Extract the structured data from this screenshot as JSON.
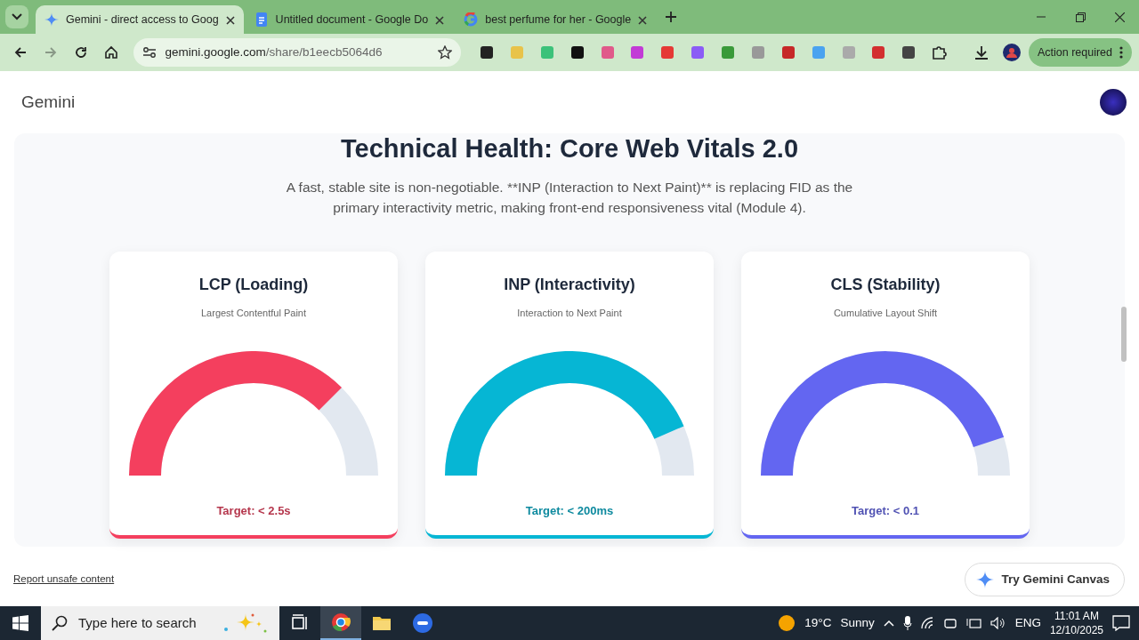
{
  "browser": {
    "tabs": [
      {
        "title": "Gemini - direct access to Goog",
        "kind": "gemini",
        "selected": true
      },
      {
        "title": "Untitled document - Google Do",
        "kind": "docs",
        "selected": false
      },
      {
        "title": "best perfume for her - Google",
        "kind": "google",
        "selected": false
      }
    ],
    "address": {
      "host": "gemini.google.com",
      "path": "/share/b1eecb5064d6"
    },
    "action_button": "Action required"
  },
  "page": {
    "app_title": "Gemini",
    "heading": "Technical Health: Core Web Vitals 2.0",
    "description": "A fast, stable site is non-negotiable. **INP (Interaction to Next Paint)** is replacing FID as the primary interactivity metric, making front-end responsiveness vital (Module 4).",
    "metrics": [
      {
        "title": "LCP (Loading)",
        "subtitle": "Largest Contentful Paint",
        "color": "#f43f5e",
        "target": "Target: < 2.5s"
      },
      {
        "title": "INP (Interactivity)",
        "subtitle": "Interaction to Next Paint",
        "color": "#06b6d4",
        "target": "Target: < 200ms"
      },
      {
        "title": "CLS (Stability)",
        "subtitle": "Cumulative Layout Shift",
        "color": "#6366f1",
        "target": "Target: < 0.1"
      }
    ],
    "report_link": "Report unsafe content",
    "canvas_button": "Try Gemini Canvas"
  },
  "taskbar": {
    "search_placeholder": "Type here to search",
    "temperature": "19°C",
    "weather": "Sunny",
    "language": "ENG",
    "time": "11:01 AM",
    "date": "12/10/2025"
  }
}
